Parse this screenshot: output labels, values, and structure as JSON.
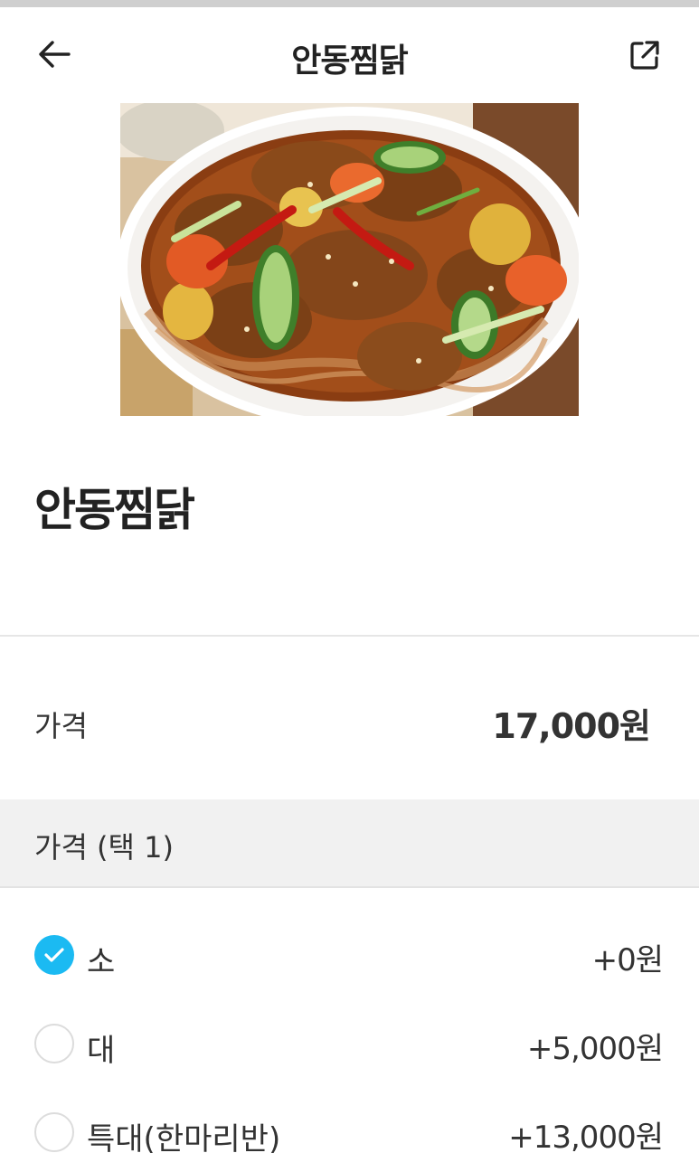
{
  "header": {
    "title": "안동찜닭",
    "back_icon": "arrow-left-icon",
    "share_icon": "share-external-icon"
  },
  "product": {
    "name": "안동찜닭",
    "image_alt": "braised-chicken-photo"
  },
  "price": {
    "label": "가격",
    "value": "17,000원"
  },
  "options_section": {
    "label": "가격 (택 1)",
    "accent_color": "#1bbaf2",
    "options": [
      {
        "label": "소",
        "price": "+0원",
        "selected": true
      },
      {
        "label": "대",
        "price": "+5,000원",
        "selected": false
      },
      {
        "label": "특대(한마리반)",
        "price": "+13,000원",
        "selected": false
      }
    ]
  }
}
